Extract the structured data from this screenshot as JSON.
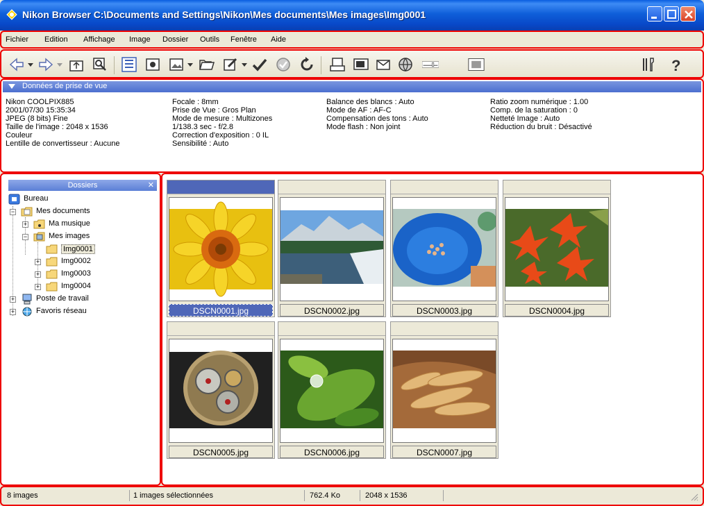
{
  "window": {
    "title": "Nikon Browser C:\\Documents and Settings\\Nikon\\Mes documents\\Mes images\\Img0001"
  },
  "menu": [
    "Fichier",
    "Edition",
    "Affichage",
    "Image",
    "Dossier",
    "Outils",
    "Fenêtre",
    "Aide"
  ],
  "shooting": {
    "header": "Données de prise de vue",
    "col1": [
      "Nikon COOLPIX885",
      "2001/07/30 15:35:34",
      "JPEG (8 bits) Fine",
      "Taille de l'image : 2048 x 1536",
      "Couleur",
      "Lentille de convertisseur : Aucune"
    ],
    "col2": [
      "Focale : 8mm",
      "Prise de Vue :  Gros Plan",
      "Mode de mesure : Multizones",
      "1/138.3 sec - f/2.8",
      "Correction d'exposition : 0 IL",
      "Sensibilité : Auto"
    ],
    "col3": [
      "Balance des blancs : Auto",
      "Mode de AF : AF-C",
      "Compensation des tons : Auto",
      "Mode flash : Non joint"
    ],
    "col4": [
      "Ratio zoom numérique : 1.00",
      "Comp. de la saturation : 0",
      "Netteté Image : Auto",
      "Réduction du bruit : Désactivé"
    ]
  },
  "folders": {
    "header": "Dossiers",
    "close": "✕",
    "items": {
      "bureau": "Bureau",
      "mes_documents": "Mes documents",
      "ma_musique": "Ma musique",
      "mes_images": "Mes images",
      "img0001": "Img0001",
      "img0002": "Img0002",
      "img0003": "Img0003",
      "img0004": "Img0004",
      "poste": "Poste de travail",
      "favoris": "Favoris réseau"
    }
  },
  "thumbnails": [
    {
      "name": "DSCN0001.jpg",
      "selected": true
    },
    {
      "name": "DSCN0002.jpg",
      "selected": false
    },
    {
      "name": "DSCN0003.jpg",
      "selected": false
    },
    {
      "name": "DSCN0004.jpg",
      "selected": false
    },
    {
      "name": "DSCN0005.jpg",
      "selected": false
    },
    {
      "name": "DSCN0006.jpg",
      "selected": false
    },
    {
      "name": "DSCN0007.jpg",
      "selected": false
    }
  ],
  "status": {
    "count": "8 images",
    "selected": "1 images sélectionnées",
    "size": "762.4 Ko",
    "dims": "2048 x 1536"
  },
  "colors": {
    "title_bar": "#0f5fd9",
    "highlight": "#e00000",
    "selection": "#4f67b8"
  }
}
